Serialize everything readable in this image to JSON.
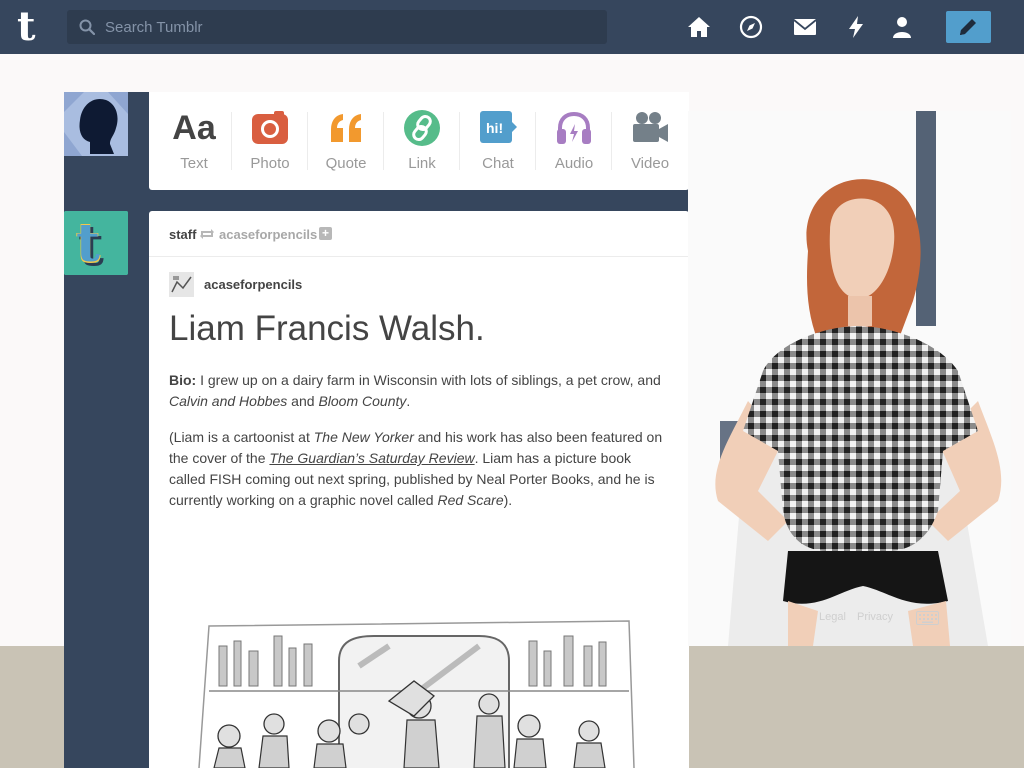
{
  "search": {
    "placeholder": "Search Tumblr"
  },
  "nav": {
    "icons": [
      "home-icon",
      "explore-compass-icon",
      "inbox-mail-icon",
      "activity-lightning-icon",
      "account-person-icon",
      "compose-pencil-icon"
    ]
  },
  "colors": {
    "navy": "#36465d",
    "compose_blue": "#529ecc",
    "text_red": "#d95e40",
    "quote_orange": "#f2992e",
    "link_green": "#56bc8a",
    "chat_blue": "#529ecc",
    "audio_purple": "#a77dc2",
    "video_gray": "#748089"
  },
  "post_types": [
    {
      "label": "Text",
      "icon": "text-aa-icon"
    },
    {
      "label": "Photo",
      "icon": "camera-icon"
    },
    {
      "label": "Quote",
      "icon": "quote-icon"
    },
    {
      "label": "Link",
      "icon": "link-chain-icon"
    },
    {
      "label": "Chat",
      "icon": "chat-bubble-icon"
    },
    {
      "label": "Audio",
      "icon": "headphones-icon"
    },
    {
      "label": "Video",
      "icon": "video-camera-icon"
    }
  ],
  "post": {
    "author": "staff",
    "reblog_from": "acaseforpencils",
    "source_name": "acaseforpencils",
    "title": "Liam Francis Walsh.",
    "para1": {
      "bio_label": "Bio:",
      "t1": " I grew up on a dairy farm in Wisconsin with lots of siblings, a pet crow, and ",
      "em1": "Calvin and Hobbes",
      "t2": " and ",
      "em2": "Bloom County",
      "t3": "."
    },
    "para2": {
      "t1": "(Liam is a cartoonist at ",
      "em1": "The New Yorker",
      "t2": " and his work has also been featured on the cover of the ",
      "link1": "The Guardian’s Saturday Review",
      "t3": ". Liam has a picture book called FISH coming out next spring, published by Neal Porter Books, and he is currently working on a graphic novel called ",
      "em2": "Red Scare",
      "t4": ")."
    }
  },
  "footer": {
    "items": [
      "Legal",
      "Privacy"
    ]
  }
}
